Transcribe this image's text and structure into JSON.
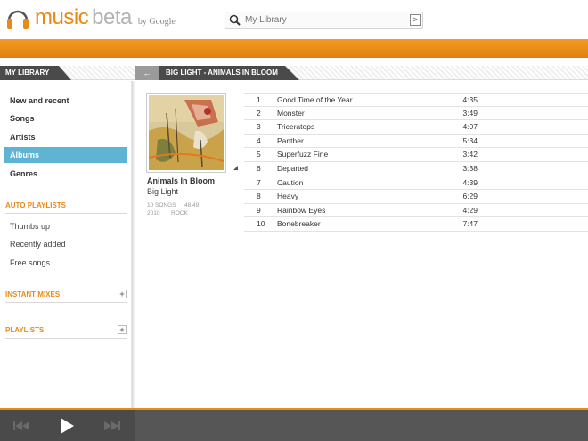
{
  "header": {
    "logo_word": "music",
    "logo_beta": "beta",
    "logo_by": "by Google",
    "search_placeholder": "My Library",
    "search_go": ">"
  },
  "library_tab": "MY LIBRARY",
  "album_tab": "BIG LIGHT - ANIMALS IN BLOOM",
  "back_label": "←",
  "sidebar": {
    "nav": [
      {
        "label": "New and recent",
        "active": false
      },
      {
        "label": "Songs",
        "active": false
      },
      {
        "label": "Artists",
        "active": false
      },
      {
        "label": "Albums",
        "active": true
      },
      {
        "label": "Genres",
        "active": false
      }
    ],
    "auto_playlists_heading": "AUTO PLAYLISTS",
    "auto_playlists": [
      "Thumbs up",
      "Recently added",
      "Free songs"
    ],
    "instant_mixes_heading": "INSTANT MIXES",
    "playlists_heading": "PLAYLISTS",
    "plus": "+"
  },
  "album": {
    "title": "Animals In Bloom",
    "artist": "Big Light",
    "song_count": "10 SONGS",
    "length": "48:49",
    "year": "2010",
    "genre": "ROCK"
  },
  "tracks": [
    {
      "num": "1",
      "name": "Good Time of the Year",
      "duration": "4:35"
    },
    {
      "num": "2",
      "name": "Monster",
      "duration": "3:49"
    },
    {
      "num": "3",
      "name": "Triceratops",
      "duration": "4:07"
    },
    {
      "num": "4",
      "name": "Panther",
      "duration": "5:34"
    },
    {
      "num": "5",
      "name": "Superfuzz Fine",
      "duration": "3:42"
    },
    {
      "num": "6",
      "name": "Departed",
      "duration": "3:38"
    },
    {
      "num": "7",
      "name": "Caution",
      "duration": "4:39"
    },
    {
      "num": "8",
      "name": "Heavy",
      "duration": "6:29"
    },
    {
      "num": "9",
      "name": "Rainbow Eyes",
      "duration": "4:29"
    },
    {
      "num": "10",
      "name": "Bonebreaker",
      "duration": "7:47"
    }
  ],
  "colors": {
    "accent": "#e98a16",
    "active_nav": "#5fb3d3",
    "player_bg": "#565656"
  },
  "icons": {
    "logo": "headphones-icon",
    "search": "search-icon",
    "prev": "previous-icon",
    "play": "play-icon",
    "next": "next-icon"
  }
}
